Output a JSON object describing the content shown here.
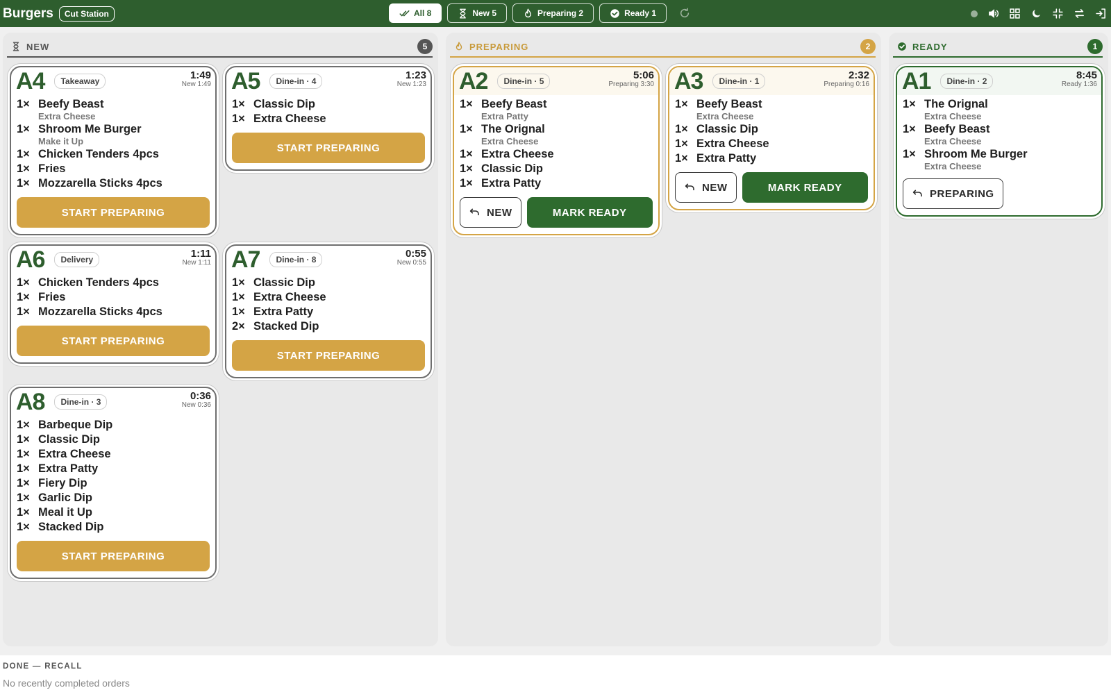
{
  "header": {
    "brand": "Burgers",
    "station": "Cut Station",
    "filters": {
      "all": "All 8",
      "new": "New 5",
      "preparing": "Preparing 2",
      "ready": "Ready 1"
    }
  },
  "columns": {
    "new": {
      "title": "NEW",
      "count": "5"
    },
    "preparing": {
      "title": "PREPARING",
      "count": "2"
    },
    "ready": {
      "title": "READY",
      "count": "1"
    }
  },
  "buttons": {
    "start": "START PREPARING",
    "mark_ready": "MARK READY",
    "back_new": "NEW",
    "back_preparing": "PREPARING"
  },
  "tickets": {
    "a4": {
      "id": "A4",
      "type": "Takeaway",
      "elapsed": "1:49",
      "status": "New 1:49",
      "items": [
        {
          "qty": "1×",
          "name": "Beefy Beast",
          "mod": "Extra Cheese"
        },
        {
          "qty": "1×",
          "name": "Shroom Me Burger",
          "mod": "Make it Up"
        },
        {
          "qty": "1×",
          "name": "Chicken Tenders 4pcs"
        },
        {
          "qty": "1×",
          "name": "Fries"
        },
        {
          "qty": "1×",
          "name": "Mozzarella Sticks 4pcs"
        }
      ]
    },
    "a5": {
      "id": "A5",
      "type": "Dine-in · 4",
      "elapsed": "1:23",
      "status": "New 1:23",
      "items": [
        {
          "qty": "1×",
          "name": "Classic Dip"
        },
        {
          "qty": "1×",
          "name": "Extra Cheese"
        }
      ]
    },
    "a6": {
      "id": "A6",
      "type": "Delivery",
      "elapsed": "1:11",
      "status": "New 1:11",
      "items": [
        {
          "qty": "1×",
          "name": "Chicken Tenders 4pcs"
        },
        {
          "qty": "1×",
          "name": "Fries"
        },
        {
          "qty": "1×",
          "name": "Mozzarella Sticks 4pcs"
        }
      ]
    },
    "a7": {
      "id": "A7",
      "type": "Dine-in · 8",
      "elapsed": "0:55",
      "status": "New 0:55",
      "items": [
        {
          "qty": "1×",
          "name": "Classic Dip"
        },
        {
          "qty": "1×",
          "name": "Extra Cheese"
        },
        {
          "qty": "1×",
          "name": "Extra Patty"
        },
        {
          "qty": "2×",
          "name": "Stacked Dip"
        }
      ]
    },
    "a8": {
      "id": "A8",
      "type": "Dine-in · 3",
      "elapsed": "0:36",
      "status": "New 0:36",
      "items": [
        {
          "qty": "1×",
          "name": "Barbeque Dip"
        },
        {
          "qty": "1×",
          "name": "Classic Dip"
        },
        {
          "qty": "1×",
          "name": "Extra Cheese"
        },
        {
          "qty": "1×",
          "name": "Extra Patty"
        },
        {
          "qty": "1×",
          "name": "Fiery Dip"
        },
        {
          "qty": "1×",
          "name": "Garlic Dip"
        },
        {
          "qty": "1×",
          "name": "Meal it Up"
        },
        {
          "qty": "1×",
          "name": "Stacked Dip"
        }
      ]
    },
    "a2": {
      "id": "A2",
      "type": "Dine-in · 5",
      "elapsed": "5:06",
      "status": "Preparing 3:30",
      "items": [
        {
          "qty": "1×",
          "name": "Beefy Beast",
          "mod": "Extra Patty"
        },
        {
          "qty": "1×",
          "name": "The Orignal",
          "mod": "Extra Cheese"
        },
        {
          "qty": "1×",
          "name": "Extra Cheese"
        },
        {
          "qty": "1×",
          "name": "Classic Dip"
        },
        {
          "qty": "1×",
          "name": "Extra Patty"
        }
      ]
    },
    "a3": {
      "id": "A3",
      "type": "Dine-in · 1",
      "elapsed": "2:32",
      "status": "Preparing 0:16",
      "items": [
        {
          "qty": "1×",
          "name": "Beefy Beast",
          "mod": "Extra Cheese"
        },
        {
          "qty": "1×",
          "name": "Classic Dip"
        },
        {
          "qty": "1×",
          "name": "Extra Cheese"
        },
        {
          "qty": "1×",
          "name": "Extra Patty"
        }
      ]
    },
    "a1": {
      "id": "A1",
      "type": "Dine-in · 2",
      "elapsed": "8:45",
      "status": "Ready 1:36",
      "items": [
        {
          "qty": "1×",
          "name": "The Orignal",
          "mod": "Extra Cheese"
        },
        {
          "qty": "1×",
          "name": "Beefy Beast",
          "mod": "Extra Cheese"
        },
        {
          "qty": "1×",
          "name": "Shroom Me Burger",
          "mod": "Extra Cheese"
        }
      ]
    }
  },
  "done": {
    "title": "DONE — RECALL",
    "empty": "No recently completed orders"
  },
  "colors": {
    "brand_green": "#2e5e2e",
    "ready_green": "#2e6b2e",
    "preparing_amber": "#d4a445",
    "new_gray": "#555555"
  }
}
